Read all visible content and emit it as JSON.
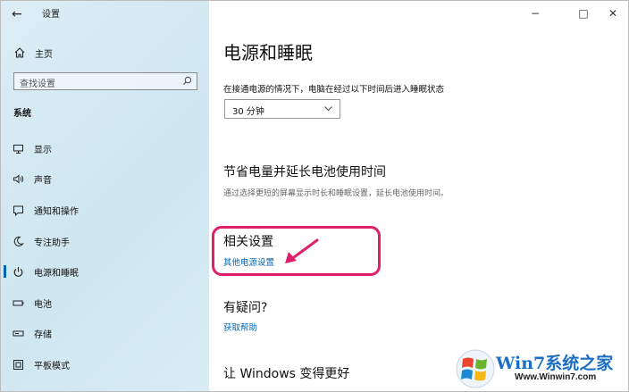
{
  "window": {
    "title": "设置",
    "back_icon": "back-arrow-icon",
    "controls": [
      "−",
      "□",
      "✕"
    ]
  },
  "sidebar": {
    "home_label": "主页",
    "home_icon": "home-icon",
    "search_placeholder": "查找设置",
    "search_icon": "search-icon",
    "section_title": "系统",
    "items": [
      {
        "label": "显示",
        "icon": "monitor-icon"
      },
      {
        "label": "声音",
        "icon": "speaker-icon"
      },
      {
        "label": "通知和操作",
        "icon": "notification-icon"
      },
      {
        "label": "专注助手",
        "icon": "moon-icon"
      },
      {
        "label": "电源和睡眠",
        "icon": "power-icon",
        "active": true
      },
      {
        "label": "电池",
        "icon": "battery-icon"
      },
      {
        "label": "存储",
        "icon": "storage-icon"
      },
      {
        "label": "平板模式",
        "icon": "tablet-icon"
      }
    ],
    "active_color": "#0067b8"
  },
  "main": {
    "page_title": "电源和睡眠",
    "sleep_desc": "在接通电源的情况下，电脑在经过以下时间后进入睡眠状态",
    "sleep_value": "30 分钟",
    "battery_heading": "节省电量并延长电池使用时间",
    "battery_text": "通过选择更短的屏幕显示时长和睡眠设置，延长电池使用时间。",
    "related_heading": "相关设置",
    "related_link": "其他电源设置",
    "question_heading": "有疑问?",
    "help_link": "获取帮助",
    "improve_heading": "让 Windows 变得更好",
    "link_color": "#0067b8",
    "highlight_color": "#e01e6a"
  },
  "watermark": {
    "title": "Win7系统之家",
    "url": "Www.Winwin7.com"
  }
}
